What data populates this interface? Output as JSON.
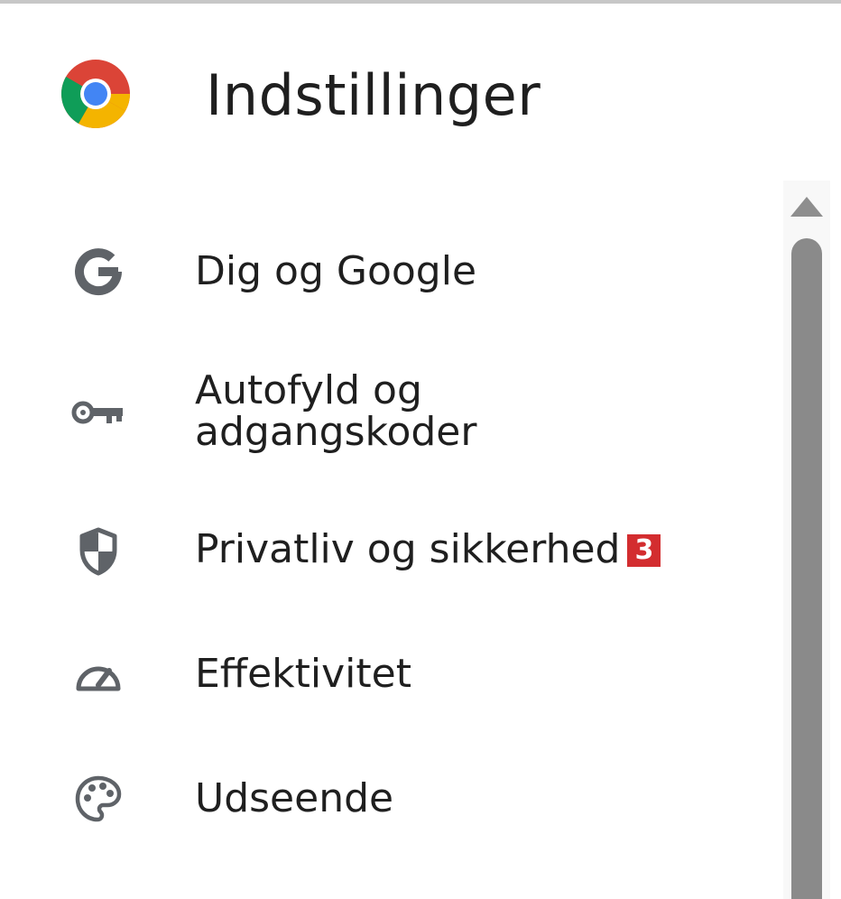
{
  "header": {
    "logo_icon": "chrome-logo-icon",
    "title": "Indstillinger"
  },
  "nav": {
    "items": [
      {
        "id": "you-and-google",
        "label": "Dig og Google",
        "icon": "google-g-icon"
      },
      {
        "id": "autofill",
        "label_line1": "Autofyld og",
        "label_line2": "adgangskoder",
        "icon": "key-icon"
      },
      {
        "id": "privacy",
        "label": "Privatliv og sikkerhed",
        "icon": "shield-icon",
        "badge": "3"
      },
      {
        "id": "performance",
        "label": "Effektivitet",
        "icon": "speedometer-icon"
      },
      {
        "id": "appearance",
        "label": "Udseende",
        "icon": "palette-icon"
      }
    ]
  },
  "colors": {
    "text": "#1f1f1f",
    "icon": "#5f6368",
    "badge_bg": "#d32d2f",
    "scroll_thumb": "#8a8a8a"
  }
}
